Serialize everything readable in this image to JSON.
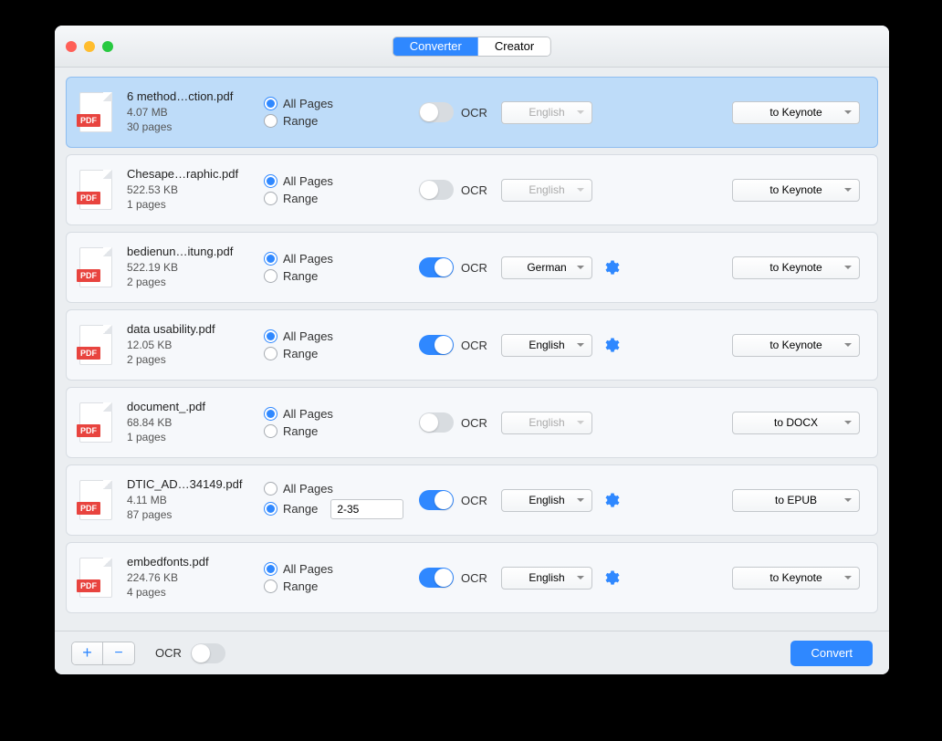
{
  "tabs": {
    "converter": "Converter",
    "creator": "Creator"
  },
  "labels": {
    "allPages": "All Pages",
    "range": "Range",
    "ocr": "OCR",
    "convert": "Convert",
    "pdfBadge": "PDF"
  },
  "files": [
    {
      "name": "6 method…ction.pdf",
      "size": "4.07 MB",
      "pages": "30 pages",
      "selected": true,
      "pagesMode": "all",
      "ocr": false,
      "lang": "English",
      "format": "to Keynote",
      "rangeValue": ""
    },
    {
      "name": "Chesape…raphic.pdf",
      "size": "522.53 KB",
      "pages": "1 pages",
      "selected": false,
      "pagesMode": "all",
      "ocr": false,
      "lang": "English",
      "format": "to Keynote",
      "rangeValue": ""
    },
    {
      "name": "bedienun…itung.pdf",
      "size": "522.19 KB",
      "pages": "2 pages",
      "selected": false,
      "pagesMode": "all",
      "ocr": true,
      "lang": "German",
      "format": "to Keynote",
      "rangeValue": ""
    },
    {
      "name": "data usability.pdf",
      "size": "12.05 KB",
      "pages": "2 pages",
      "selected": false,
      "pagesMode": "all",
      "ocr": true,
      "lang": "English",
      "format": "to Keynote",
      "rangeValue": ""
    },
    {
      "name": "document_.pdf",
      "size": "68.84 KB",
      "pages": "1 pages",
      "selected": false,
      "pagesMode": "all",
      "ocr": false,
      "lang": "English",
      "format": "to DOCX",
      "rangeValue": ""
    },
    {
      "name": "DTIC_AD…34149.pdf",
      "size": "4.11 MB",
      "pages": "87 pages",
      "selected": false,
      "pagesMode": "range",
      "ocr": true,
      "lang": "English",
      "format": "to EPUB",
      "rangeValue": "2-35"
    },
    {
      "name": "embedfonts.pdf",
      "size": "224.76 KB",
      "pages": "4 pages",
      "selected": false,
      "pagesMode": "all",
      "ocr": true,
      "lang": "English",
      "format": "to Keynote",
      "rangeValue": ""
    }
  ],
  "footer": {
    "ocr": false
  }
}
